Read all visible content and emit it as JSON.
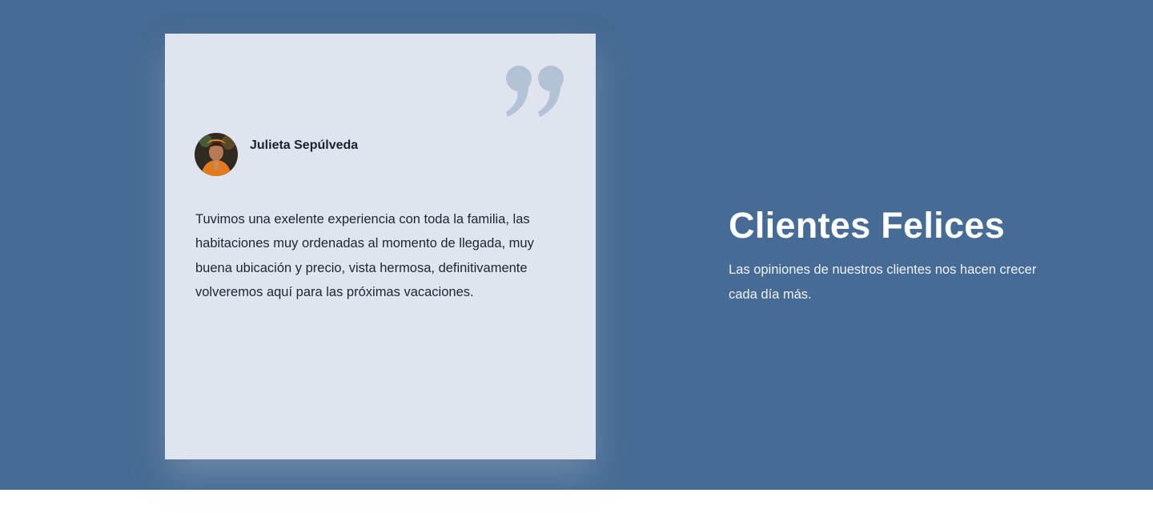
{
  "colors": {
    "section_background": "#466b94",
    "card_background": "#dfe5ee",
    "quote_icon": "#b3c3d5",
    "heading": "#ffffff"
  },
  "testimonial": {
    "quote_icon": "quote-close-icon",
    "author_name": "Julieta Sepúlveda",
    "text": "Tuvimos una exelente experiencia con toda la familia, las habitaciones muy ordenadas al momento de llegada, muy buena ubicación y precio, vista hermosa, definitivamente volveremos aquí para las próximas vacaciones."
  },
  "intro": {
    "title": "Clientes Felices",
    "description": "Las opiniones de nuestros clientes nos hacen crecer cada día más."
  }
}
